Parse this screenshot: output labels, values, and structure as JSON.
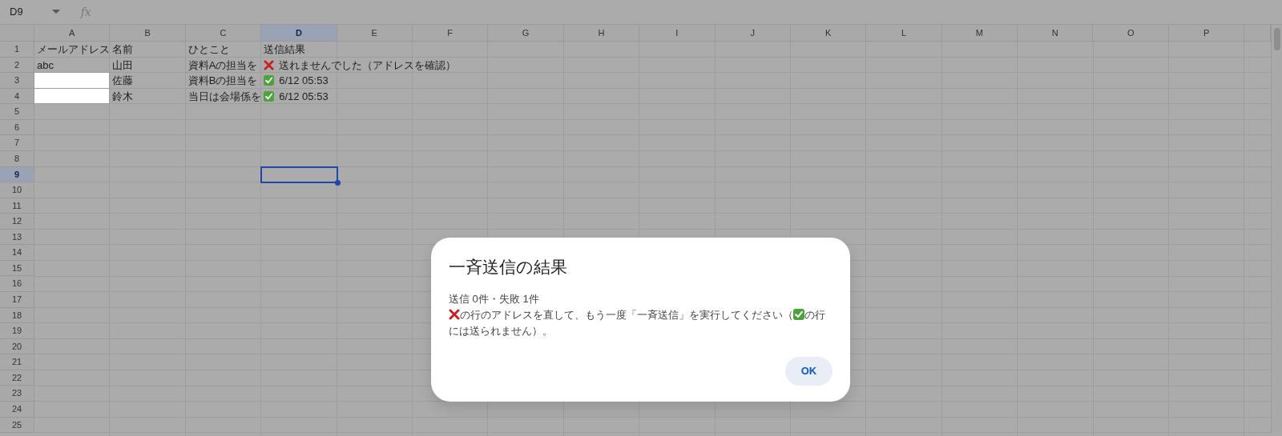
{
  "formula_bar": {
    "name_box": "D9",
    "function_label": "fx"
  },
  "columns": [
    {
      "label": "A",
      "selected": false
    },
    {
      "label": "B",
      "selected": false
    },
    {
      "label": "C",
      "selected": false
    },
    {
      "label": "D",
      "selected": true
    },
    {
      "label": "E",
      "selected": false
    },
    {
      "label": "F",
      "selected": false
    },
    {
      "label": "G",
      "selected": false
    },
    {
      "label": "H",
      "selected": false
    },
    {
      "label": "I",
      "selected": false
    },
    {
      "label": "J",
      "selected": false
    },
    {
      "label": "K",
      "selected": false
    },
    {
      "label": "L",
      "selected": false
    },
    {
      "label": "M",
      "selected": false
    },
    {
      "label": "N",
      "selected": false
    },
    {
      "label": "O",
      "selected": false
    },
    {
      "label": "P",
      "selected": false
    }
  ],
  "rows": [
    {
      "label": "1",
      "selected": false,
      "cells": [
        {
          "text": "メールアドレス",
          "highlighted": false
        },
        {
          "text": "名前",
          "highlighted": false
        },
        {
          "text": "ひとこと",
          "highlighted": false
        },
        {
          "text": "送信結果",
          "highlighted": false
        }
      ]
    },
    {
      "label": "2",
      "selected": false,
      "cells": [
        {
          "text": "abc",
          "highlighted": false
        },
        {
          "text": "山田",
          "highlighted": false
        },
        {
          "text": "資料Aの担当を",
          "highlighted": false
        },
        {
          "kind": "result",
          "sent": false,
          "text": "送れませんでした（アドレスを確認）",
          "highlighted": false
        }
      ]
    },
    {
      "label": "3",
      "selected": false,
      "cells": [
        {
          "highlighted": true
        },
        {
          "text": "佐藤",
          "highlighted": false
        },
        {
          "text": "資料Bの担当を",
          "highlighted": false
        },
        {
          "kind": "result",
          "sent": true,
          "text": "6/12 05:53",
          "highlighted": false
        }
      ]
    },
    {
      "label": "4",
      "selected": false,
      "cells": [
        {
          "highlighted": true
        },
        {
          "text": "鈴木",
          "highlighted": false
        },
        {
          "text": "当日は会場係を",
          "highlighted": false
        },
        {
          "kind": "result",
          "sent": true,
          "text": "6/12 05:53",
          "highlighted": false
        }
      ]
    },
    {
      "label": "5",
      "selected": false
    },
    {
      "label": "6",
      "selected": false
    },
    {
      "label": "7",
      "selected": false
    },
    {
      "label": "8",
      "selected": false
    },
    {
      "label": "9",
      "selected": true
    },
    {
      "label": "10",
      "selected": false
    },
    {
      "label": "11",
      "selected": false
    },
    {
      "label": "12",
      "selected": false
    },
    {
      "label": "13",
      "selected": false
    },
    {
      "label": "14",
      "selected": false
    },
    {
      "label": "15",
      "selected": false
    },
    {
      "label": "16",
      "selected": false
    },
    {
      "label": "17",
      "selected": false
    },
    {
      "label": "18",
      "selected": false
    },
    {
      "label": "19",
      "selected": false
    },
    {
      "label": "20",
      "selected": false
    },
    {
      "label": "21",
      "selected": false
    },
    {
      "label": "22",
      "selected": false
    },
    {
      "label": "23",
      "selected": false
    },
    {
      "label": "24",
      "selected": false
    },
    {
      "label": "25",
      "selected": false
    }
  ],
  "dialog": {
    "title": "一斉送信の結果",
    "summary": "送信 0件・失敗 1件",
    "message": [
      {
        "kind": "mark",
        "sent": false
      },
      {
        "kind": "text",
        "text": "の行のアドレスを直して、もう一度「一斉送信」を実行してください（"
      },
      {
        "kind": "mark",
        "sent": true
      },
      {
        "kind": "text",
        "text": "の行"
      },
      {
        "kind": "text",
        "text": "には送られません）。"
      }
    ],
    "button": "OK"
  }
}
